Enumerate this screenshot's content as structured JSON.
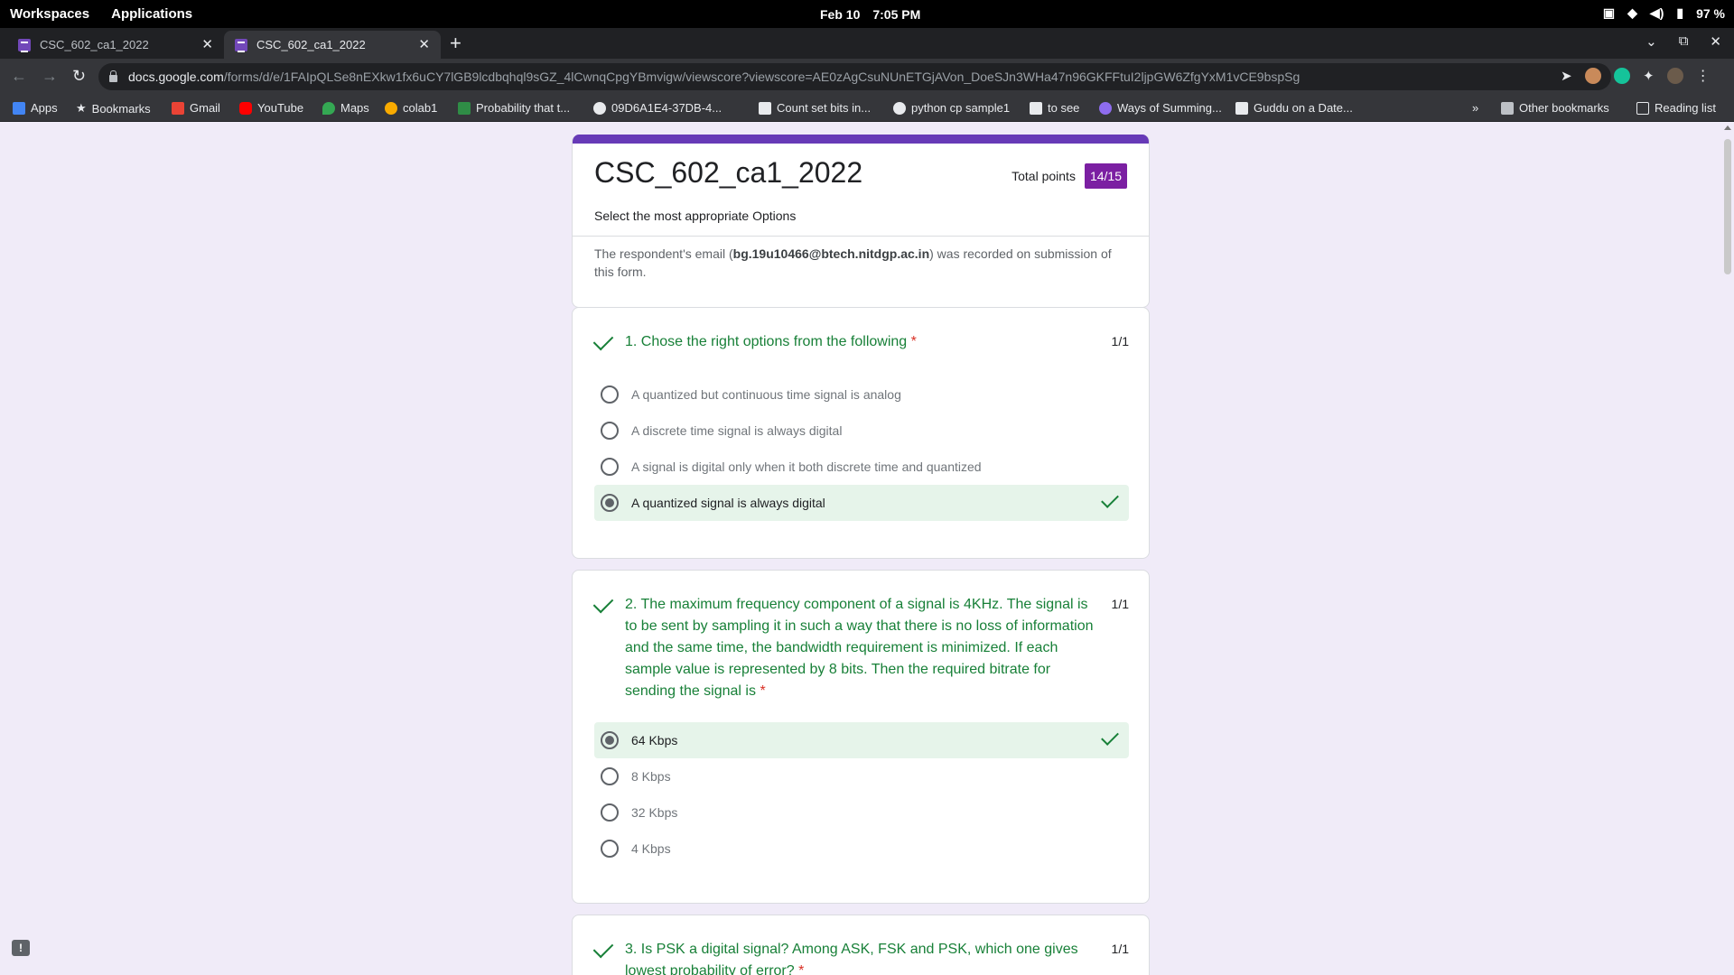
{
  "os_bar": {
    "workspaces": "Workspaces",
    "applications": "Applications",
    "date": "Feb 10",
    "time": "7:05 PM",
    "battery": "97 %"
  },
  "tabs": [
    {
      "title": "CSC_602_ca1_2022"
    },
    {
      "title": "CSC_602_ca1_2022"
    }
  ],
  "address_bar": {
    "host": "docs.google.com",
    "path": "/forms/d/e/1FAIpQLSe8nEXkw1fx6uCY7lGB9lcdbqhql9sGZ_4lCwnqCpgYBmvigw/viewscore?viewscore=AE0zAgCsuNUnETGjAVon_DoeSJn3WHa47n96GKFFtuI2ljpGW6ZfgYxM1vCE9bspSg"
  },
  "bookmarks": [
    {
      "label": "Apps",
      "icon": "apps-grid-icon"
    },
    {
      "label": "Bookmarks",
      "icon": "star-icon"
    },
    {
      "label": "Gmail",
      "icon": "gmail-icon"
    },
    {
      "label": "YouTube",
      "icon": "youtube-icon"
    },
    {
      "label": "Maps",
      "icon": "maps-icon"
    },
    {
      "label": "colab1",
      "icon": "colab-icon"
    },
    {
      "label": "Probability that t...",
      "icon": "gfg-icon"
    },
    {
      "label": "09D6A1E4-37DB-4...",
      "icon": "globe-icon"
    },
    {
      "label": "Count set bits in...",
      "icon": "gfg-icon"
    },
    {
      "label": "python cp sample1",
      "icon": "globe-icon"
    },
    {
      "label": "to see",
      "icon": "codechef-icon"
    },
    {
      "label": "Ways of Summing...",
      "icon": "page-icon"
    },
    {
      "label": "Guddu on a Date...",
      "icon": "codechef-icon"
    },
    {
      "label": "Other bookmarks",
      "icon": "folder-icon"
    },
    {
      "label": "Reading list",
      "icon": "reading-list-icon"
    }
  ],
  "form": {
    "title": "CSC_602_ca1_2022",
    "description": "Select the most appropriate Options",
    "total_points_label": "Total points",
    "score": "14/15",
    "email_prefix": "The respondent's email (",
    "email": "bg.19u10466@btech.nitdgp.ac.in",
    "email_suffix": ") was recorded on submission of this form."
  },
  "questions": [
    {
      "text": "1. Chose the right options from the following",
      "required": "*",
      "points": "1/1",
      "options": [
        "A quantized but continuous time signal is analog",
        "A discrete time signal is always digital",
        "A signal is digital only when it both discrete time and quantized",
        "A quantized signal is always digital"
      ],
      "selected": 3
    },
    {
      "text": "2. The maximum frequency component of a signal is 4KHz. The signal is to be sent by sampling it in such a way that there is no loss of information and the same time, the bandwidth requirement is minimized. If each sample value is represented by 8 bits. Then the required bitrate for sending the signal is",
      "required": "*",
      "points": "1/1",
      "options": [
        "64 Kbps",
        "8 Kbps",
        "32 Kbps",
        "4 Kbps"
      ],
      "selected": 0
    },
    {
      "text": "3. Is PSK a digital signal? Among ASK, FSK and PSK, which one gives lowest probability of error?",
      "required": "*",
      "points": "1/1",
      "options": [],
      "selected": null
    }
  ],
  "colors": {
    "page_bg": "#f0ebf8",
    "accent": "#673ab7",
    "score_badge": "#7b1fa2",
    "correct_green": "#188038",
    "correct_bg": "#e6f4ea",
    "required_red": "#d93025"
  }
}
